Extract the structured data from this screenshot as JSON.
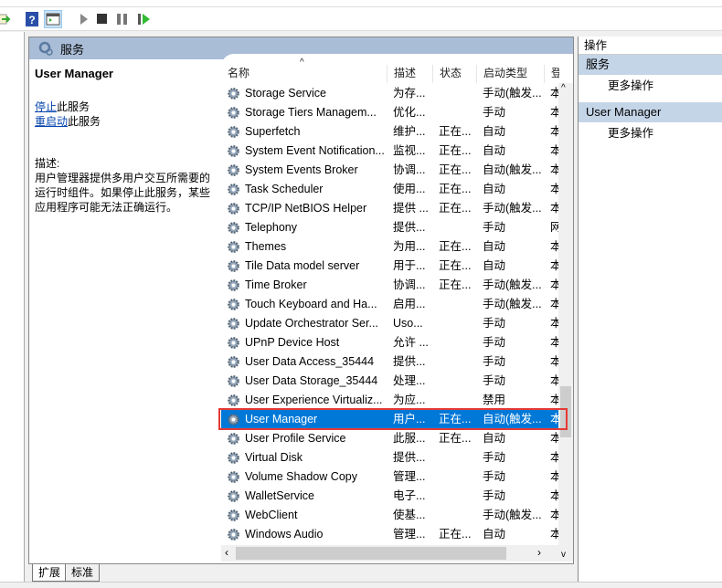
{
  "header": {
    "title": "服务"
  },
  "details": {
    "service_name": "User Manager",
    "stop_link": "停止",
    "stop_suffix": "此服务",
    "restart_link": "重启动",
    "restart_suffix": "此服务",
    "desc_label": "描述:",
    "desc_text": "用户管理器提供多用户交互所需要的运行时组件。如果停止此服务，某些应用程序可能无法正确运行。"
  },
  "columns": [
    "名称",
    "描述",
    "状态",
    "启动类型",
    "登"
  ],
  "rows": [
    [
      "Storage Service",
      "为存...",
      "",
      "手动(触发...",
      "本"
    ],
    [
      "Storage Tiers Managem...",
      "优化...",
      "",
      "手动",
      "本"
    ],
    [
      "Superfetch",
      "维护...",
      "正在...",
      "自动",
      "本"
    ],
    [
      "System Event Notification...",
      "监视...",
      "正在...",
      "自动",
      "本"
    ],
    [
      "System Events Broker",
      "协调...",
      "正在...",
      "自动(触发...",
      "本"
    ],
    [
      "Task Scheduler",
      "使用...",
      "正在...",
      "自动",
      "本"
    ],
    [
      "TCP/IP NetBIOS Helper",
      "提供 ...",
      "正在...",
      "手动(触发...",
      "本"
    ],
    [
      "Telephony",
      "提供...",
      "",
      "手动",
      "网"
    ],
    [
      "Themes",
      "为用...",
      "正在...",
      "自动",
      "本"
    ],
    [
      "Tile Data model server",
      "用于...",
      "正在...",
      "自动",
      "本"
    ],
    [
      "Time Broker",
      "协调...",
      "正在...",
      "手动(触发...",
      "本"
    ],
    [
      "Touch Keyboard and Ha...",
      "启用...",
      "",
      "手动(触发...",
      "本"
    ],
    [
      "Update Orchestrator Ser...",
      "Uso...",
      "",
      "手动",
      "本"
    ],
    [
      "UPnP Device Host",
      "允许 ...",
      "",
      "手动",
      "本"
    ],
    [
      "User Data Access_35444",
      "提供...",
      "",
      "手动",
      "本"
    ],
    [
      "User Data Storage_35444",
      "处理...",
      "",
      "手动",
      "本"
    ],
    [
      "User Experience Virtualiz...",
      "为应...",
      "",
      "禁用",
      "本"
    ],
    [
      "User Manager",
      "用户...",
      "正在...",
      "自动(触发...",
      "本"
    ],
    [
      "User Profile Service",
      "此服...",
      "正在...",
      "自动",
      "本"
    ],
    [
      "Virtual Disk",
      "提供...",
      "",
      "手动",
      "本"
    ],
    [
      "Volume Shadow Copy",
      "管理...",
      "",
      "手动",
      "本"
    ],
    [
      "WalletService",
      "电子...",
      "",
      "手动",
      "本"
    ],
    [
      "WebClient",
      "使基...",
      "",
      "手动(触发...",
      "本"
    ],
    [
      "Windows Audio",
      "管理...",
      "正在...",
      "自动",
      "本"
    ]
  ],
  "selected_row": "User Manager",
  "actions": {
    "title": "操作",
    "sections": [
      {
        "label": "服务",
        "item": "更多操作"
      },
      {
        "label": "User Manager",
        "item": "更多操作"
      }
    ]
  },
  "tabs": [
    "扩展",
    "标准"
  ],
  "colors": {
    "selection": "#0078d7",
    "highlight_box": "#e53935",
    "header_bar": "#a9bdd6"
  }
}
